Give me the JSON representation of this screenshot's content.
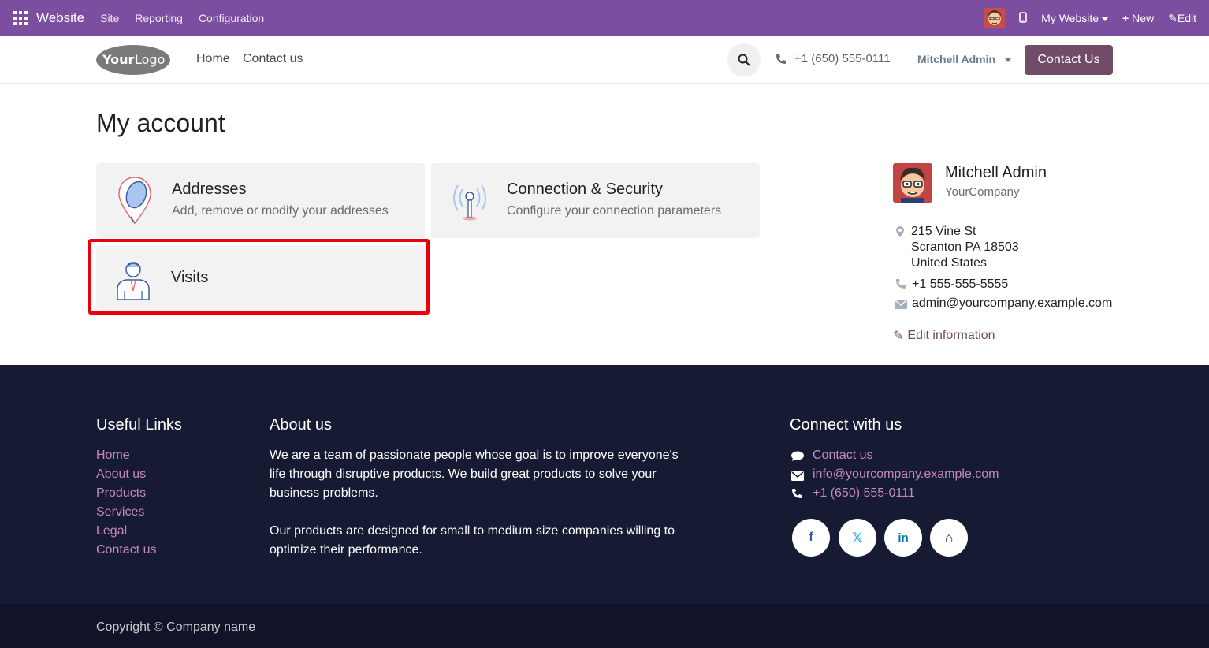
{
  "adminbar": {
    "brand": "Website",
    "menus": [
      "Site",
      "Reporting",
      "Configuration"
    ],
    "my_website": "My Website",
    "new": "New",
    "edit": "Edit"
  },
  "header": {
    "logo_text": "YourLogo",
    "nav": [
      "Home",
      "Contact us"
    ],
    "phone": "+1 (650) 555-0111",
    "user": "Mitchell Admin",
    "contact_button": "Contact Us"
  },
  "main": {
    "title": "My account",
    "cards": [
      {
        "title": "Addresses",
        "desc": "Add, remove or modify your addresses"
      },
      {
        "title": "Connection & Security",
        "desc": "Configure your connection parameters"
      },
      {
        "title": "Visits",
        "desc": ""
      }
    ]
  },
  "profile": {
    "name": "Mitchell Admin",
    "company": "YourCompany",
    "address_line1": "215 Vine St",
    "address_line2": "Scranton PA 18503",
    "address_line3": "United States",
    "phone": "+1 555-555-5555",
    "email": "admin@yourcompany.example.com",
    "edit": "Edit information"
  },
  "footer": {
    "useful_links_title": "Useful Links",
    "useful_links": [
      "Home",
      "About us",
      "Products",
      "Services",
      "Legal",
      "Contact us"
    ],
    "about_title": "About us",
    "about_p1": "We are a team of passionate people whose goal is to improve everyone's life through disruptive products. We build great products to solve your business problems.",
    "about_p2": "Our products are designed for small to medium size companies willing to optimize their performance.",
    "connect_title": "Connect with us",
    "connect_contact": "Contact us",
    "connect_email": "info@yourcompany.example.com",
    "connect_phone": "+1 (650) 555-0111",
    "social": [
      "f",
      "𝕏",
      "in",
      "⌂"
    ],
    "copyright": "Copyright © Company name"
  },
  "colors": {
    "admin_bar": "#7c4ea0",
    "primary": "#714b67",
    "footer_bg": "#161a33",
    "highlight": "#e8000b"
  }
}
